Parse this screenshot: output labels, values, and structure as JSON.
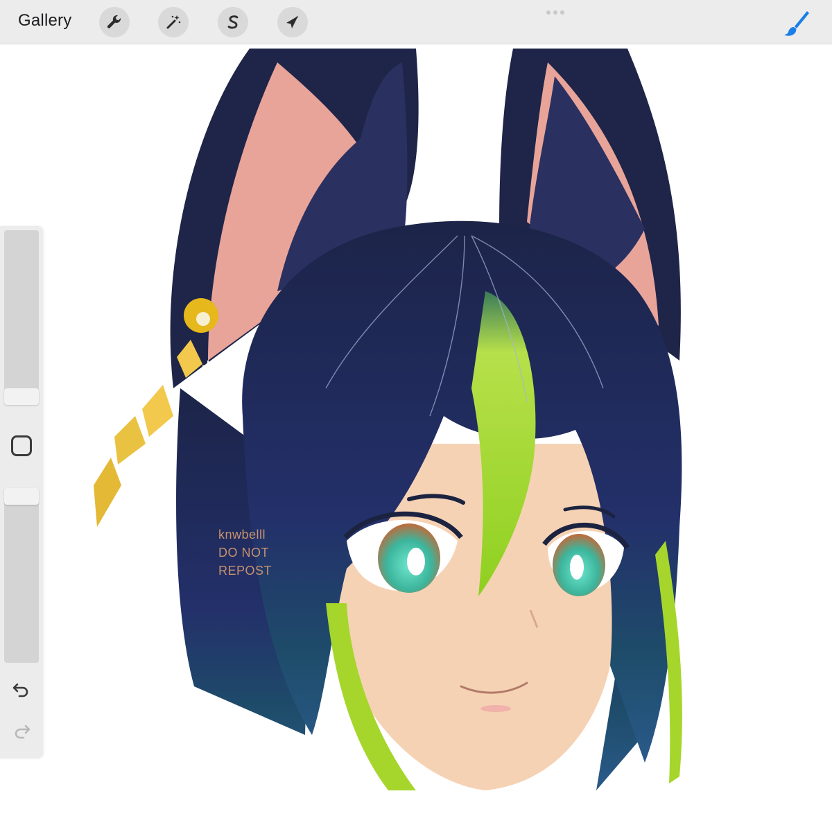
{
  "toolbar": {
    "gallery_label": "Gallery",
    "tools": [
      {
        "name": "actions",
        "icon": "wrench-icon"
      },
      {
        "name": "adjustments",
        "icon": "magic-wand-icon"
      },
      {
        "name": "selection",
        "icon": "selection-s-icon"
      },
      {
        "name": "transform",
        "icon": "arrow-cursor-icon"
      }
    ],
    "brush_icon": "brush-icon",
    "accent_color": "#1a7fe6"
  },
  "sidebar": {
    "brush_size_level": 0.04,
    "opacity_level": 0.96,
    "modify_icon": "square-modify-icon",
    "undo_icon": "undo-icon",
    "redo_icon": "redo-icon"
  },
  "canvas": {
    "watermark": [
      "knwbelll",
      "DO NOT",
      "REPOST"
    ],
    "background_color": "#ffffff"
  }
}
